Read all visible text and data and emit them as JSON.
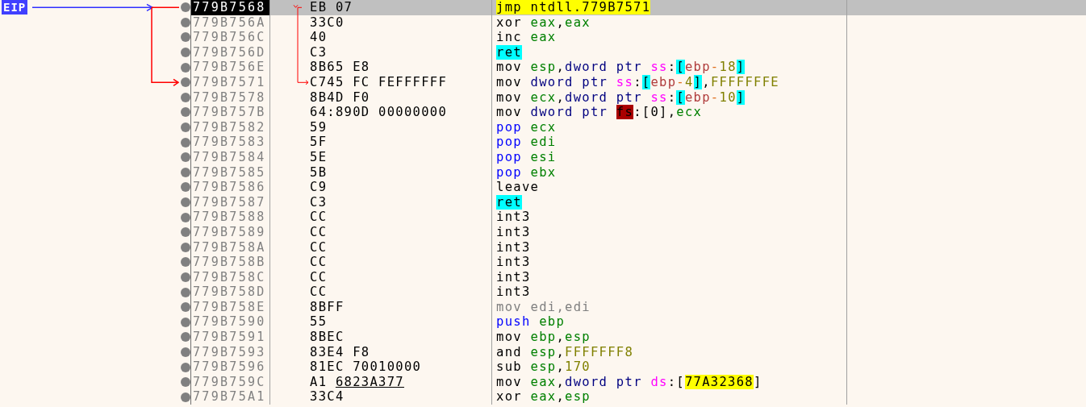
{
  "eip_label": "EIP",
  "rows": [
    {
      "address": "779B7568",
      "bytes": "EB 07",
      "selected": true,
      "eip": true,
      "tokens": [
        {
          "text": "jmp ",
          "kind": "jump"
        },
        {
          "text": "ntdll.779B7571",
          "kind": "addr"
        }
      ]
    },
    {
      "address": "779B756A",
      "bytes": "33C0",
      "selected": false,
      "eip": false,
      "tokens": [
        {
          "text": "xor ",
          "kind": "mnemonic"
        },
        {
          "text": "eax",
          "kind": "reg"
        },
        {
          "text": ",",
          "kind": "punct"
        },
        {
          "text": "eax",
          "kind": "reg"
        }
      ]
    },
    {
      "address": "779B756C",
      "bytes": "40",
      "selected": false,
      "eip": false,
      "tokens": [
        {
          "text": "inc ",
          "kind": "mnemonic"
        },
        {
          "text": "eax",
          "kind": "reg"
        }
      ]
    },
    {
      "address": "779B756D",
      "bytes": "C3",
      "selected": false,
      "eip": false,
      "tokens": [
        {
          "text": "ret",
          "kind": "ret"
        }
      ]
    },
    {
      "address": "779B756E",
      "bytes": "8B65 E8",
      "selected": false,
      "eip": false,
      "tokens": [
        {
          "text": "mov ",
          "kind": "mnemonic"
        },
        {
          "text": "esp",
          "kind": "reg"
        },
        {
          "text": ",",
          "kind": "punct"
        },
        {
          "text": "dword ptr ",
          "kind": "size"
        },
        {
          "text": "ss",
          "kind": "seg"
        },
        {
          "text": ":",
          "kind": "punct"
        },
        {
          "text": "[",
          "kind": "bracket"
        },
        {
          "text": "ebp",
          "kind": "membase"
        },
        {
          "text": "-",
          "kind": "op"
        },
        {
          "text": "18",
          "kind": "num"
        },
        {
          "text": "]",
          "kind": "bracket"
        }
      ]
    },
    {
      "address": "779B7571",
      "bytes": "C745 FC FEFFFFFF",
      "selected": false,
      "eip": false,
      "tokens": [
        {
          "text": "mov ",
          "kind": "mnemonic"
        },
        {
          "text": "dword ptr ",
          "kind": "size"
        },
        {
          "text": "ss",
          "kind": "seg"
        },
        {
          "text": ":",
          "kind": "punct"
        },
        {
          "text": "[",
          "kind": "bracket"
        },
        {
          "text": "ebp",
          "kind": "membase"
        },
        {
          "text": "-",
          "kind": "op"
        },
        {
          "text": "4",
          "kind": "num"
        },
        {
          "text": "]",
          "kind": "bracket"
        },
        {
          "text": ",",
          "kind": "punct"
        },
        {
          "text": "FFFFFFFE",
          "kind": "num"
        }
      ]
    },
    {
      "address": "779B7578",
      "bytes": "8B4D F0",
      "selected": false,
      "eip": false,
      "tokens": [
        {
          "text": "mov ",
          "kind": "mnemonic"
        },
        {
          "text": "ecx",
          "kind": "reg"
        },
        {
          "text": ",",
          "kind": "punct"
        },
        {
          "text": "dword ptr ",
          "kind": "size"
        },
        {
          "text": "ss",
          "kind": "seg"
        },
        {
          "text": ":",
          "kind": "punct"
        },
        {
          "text": "[",
          "kind": "bracket"
        },
        {
          "text": "ebp",
          "kind": "membase"
        },
        {
          "text": "-",
          "kind": "op"
        },
        {
          "text": "10",
          "kind": "num"
        },
        {
          "text": "]",
          "kind": "bracket"
        }
      ]
    },
    {
      "address": "779B757B",
      "bytes": "64:890D 00000000",
      "selected": false,
      "eip": false,
      "tokens": [
        {
          "text": "mov ",
          "kind": "mnemonic"
        },
        {
          "text": "dword ptr ",
          "kind": "size"
        },
        {
          "text": "fs",
          "kind": "fs"
        },
        {
          "text": ":[0],",
          "kind": "punct"
        },
        {
          "text": "ecx",
          "kind": "reg"
        }
      ]
    },
    {
      "address": "779B7582",
      "bytes": "59",
      "selected": false,
      "eip": false,
      "tokens": [
        {
          "text": "pop ",
          "kind": "stack"
        },
        {
          "text": "ecx",
          "kind": "reg"
        }
      ]
    },
    {
      "address": "779B7583",
      "bytes": "5F",
      "selected": false,
      "eip": false,
      "tokens": [
        {
          "text": "pop ",
          "kind": "stack"
        },
        {
          "text": "edi",
          "kind": "reg"
        }
      ]
    },
    {
      "address": "779B7584",
      "bytes": "5E",
      "selected": false,
      "eip": false,
      "tokens": [
        {
          "text": "pop ",
          "kind": "stack"
        },
        {
          "text": "esi",
          "kind": "reg"
        }
      ]
    },
    {
      "address": "779B7585",
      "bytes": "5B",
      "selected": false,
      "eip": false,
      "tokens": [
        {
          "text": "pop ",
          "kind": "stack"
        },
        {
          "text": "ebx",
          "kind": "reg"
        }
      ]
    },
    {
      "address": "779B7586",
      "bytes": "C9",
      "selected": false,
      "eip": false,
      "tokens": [
        {
          "text": "leave",
          "kind": "mnemonic"
        }
      ]
    },
    {
      "address": "779B7587",
      "bytes": "C3",
      "selected": false,
      "eip": false,
      "tokens": [
        {
          "text": "ret",
          "kind": "ret"
        }
      ]
    },
    {
      "address": "779B7588",
      "bytes": "CC",
      "selected": false,
      "eip": false,
      "tokens": [
        {
          "text": "int3",
          "kind": "mnemonic"
        }
      ]
    },
    {
      "address": "779B7589",
      "bytes": "CC",
      "selected": false,
      "eip": false,
      "tokens": [
        {
          "text": "int3",
          "kind": "mnemonic"
        }
      ]
    },
    {
      "address": "779B758A",
      "bytes": "CC",
      "selected": false,
      "eip": false,
      "tokens": [
        {
          "text": "int3",
          "kind": "mnemonic"
        }
      ]
    },
    {
      "address": "779B758B",
      "bytes": "CC",
      "selected": false,
      "eip": false,
      "tokens": [
        {
          "text": "int3",
          "kind": "mnemonic"
        }
      ]
    },
    {
      "address": "779B758C",
      "bytes": "CC",
      "selected": false,
      "eip": false,
      "tokens": [
        {
          "text": "int3",
          "kind": "mnemonic"
        }
      ]
    },
    {
      "address": "779B758D",
      "bytes": "CC",
      "selected": false,
      "eip": false,
      "tokens": [
        {
          "text": "int3",
          "kind": "mnemonic"
        }
      ]
    },
    {
      "address": "779B758E",
      "bytes": "8BFF",
      "selected": false,
      "eip": false,
      "tokens": [
        {
          "text": "mov edi,edi",
          "kind": "nop"
        }
      ]
    },
    {
      "address": "779B7590",
      "bytes": "55",
      "selected": false,
      "eip": false,
      "tokens": [
        {
          "text": "push ",
          "kind": "stack"
        },
        {
          "text": "ebp",
          "kind": "reg"
        }
      ]
    },
    {
      "address": "779B7591",
      "bytes": "8BEC",
      "selected": false,
      "eip": false,
      "tokens": [
        {
          "text": "mov ",
          "kind": "mnemonic"
        },
        {
          "text": "ebp",
          "kind": "reg"
        },
        {
          "text": ",",
          "kind": "punct"
        },
        {
          "text": "esp",
          "kind": "reg"
        }
      ]
    },
    {
      "address": "779B7593",
      "bytes": "83E4 F8",
      "selected": false,
      "eip": false,
      "tokens": [
        {
          "text": "and ",
          "kind": "mnemonic"
        },
        {
          "text": "esp",
          "kind": "reg"
        },
        {
          "text": ",",
          "kind": "punct"
        },
        {
          "text": "FFFFFFF8",
          "kind": "num"
        }
      ]
    },
    {
      "address": "779B7596",
      "bytes": "81EC 70010000",
      "selected": false,
      "eip": false,
      "tokens": [
        {
          "text": "sub ",
          "kind": "mnemonic"
        },
        {
          "text": "esp",
          "kind": "reg"
        },
        {
          "text": ",",
          "kind": "punct"
        },
        {
          "text": "170",
          "kind": "num"
        }
      ]
    },
    {
      "address": "779B759C",
      "bytes": "A1",
      "reloc": "6823A377",
      "selected": false,
      "eip": false,
      "tokens": [
        {
          "text": "mov ",
          "kind": "mnemonic"
        },
        {
          "text": "eax",
          "kind": "reg"
        },
        {
          "text": ",",
          "kind": "punct"
        },
        {
          "text": "dword ptr ",
          "kind": "size"
        },
        {
          "text": "ds",
          "kind": "seg"
        },
        {
          "text": ":[",
          "kind": "punct"
        },
        {
          "text": "77A32368",
          "kind": "addr"
        },
        {
          "text": "]",
          "kind": "punct"
        }
      ]
    },
    {
      "address": "779B75A1",
      "bytes": "33C4",
      "selected": false,
      "eip": false,
      "tokens": [
        {
          "text": "xor ",
          "kind": "mnemonic"
        },
        {
          "text": "eax",
          "kind": "reg"
        },
        {
          "text": ",",
          "kind": "punct"
        },
        {
          "text": "esp",
          "kind": "reg"
        }
      ]
    }
  ]
}
